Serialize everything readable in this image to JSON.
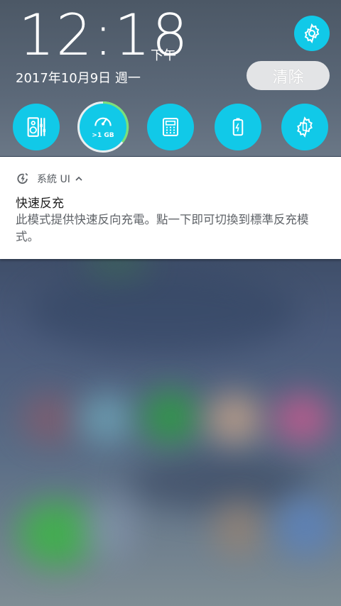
{
  "status": {
    "time": "12:18",
    "ampm": "下午",
    "date": "2017年10月9日 週一"
  },
  "actions": {
    "clear_label": "清除"
  },
  "quick_settings": [
    {
      "icon": "mixer-icon"
    },
    {
      "icon": "speedometer-icon",
      "label": ">1 GB"
    },
    {
      "icon": "calculator-icon"
    },
    {
      "icon": "battery-icon"
    },
    {
      "icon": "power-saver-gear-icon"
    }
  ],
  "notification": {
    "app_name": "系統 UI",
    "title": "快速反充",
    "text": "此模式提供快速反向充電。點一下即可切換到標準反充模式。"
  },
  "colors": {
    "accent": "#11c9e8",
    "ring_progress": "#7be07a"
  }
}
